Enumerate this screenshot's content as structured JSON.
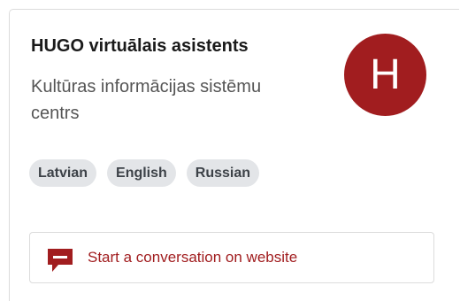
{
  "card": {
    "title": "HUGO virtuālais asistents",
    "subtitle": "Kultūras informācijas sistēmu centrs",
    "avatar_letter": "H",
    "avatar_color": "#a11d1f"
  },
  "languages": [
    "Latvian",
    "English",
    "Russian"
  ],
  "cta": {
    "label": "Start a conversation on website",
    "icon": "chat-bubble-icon",
    "color": "#a11d1f"
  }
}
